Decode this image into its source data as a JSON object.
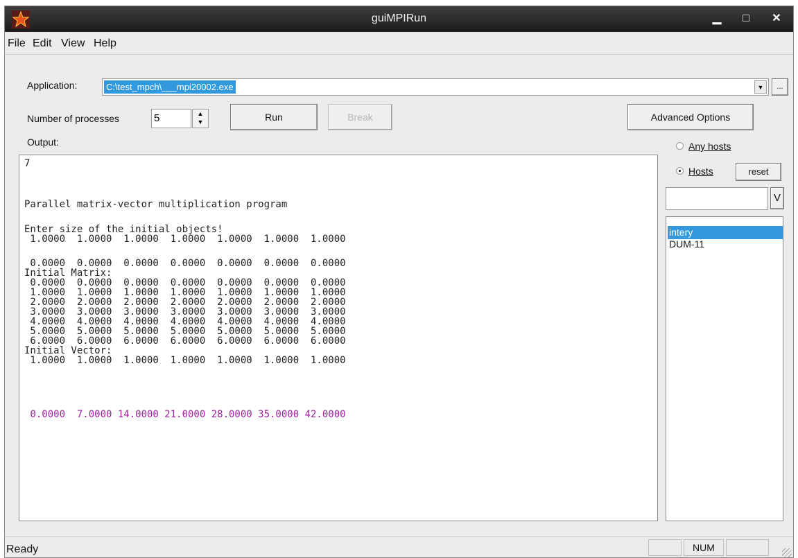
{
  "window": {
    "title": "guiMPIRun"
  },
  "menu": [
    {
      "label": "File"
    },
    {
      "label": "Edit"
    },
    {
      "label": "View"
    },
    {
      "label": "Help"
    }
  ],
  "application": {
    "label": "Application:",
    "value": "C:\\test_mpch\\___mpi20002.exe",
    "browse_label": "..."
  },
  "processes": {
    "label": "Number of processes",
    "value": "5"
  },
  "buttons": {
    "run": "Run",
    "break": "Break",
    "advanced": "Advanced Options"
  },
  "output": {
    "label": "Output:",
    "lines": [
      "7",
      "",
      "",
      "Parallel matrix-vector multiplication program",
      "",
      "Enter size of the initial objects!",
      " 1.0000  1.0000  1.0000  1.0000  1.0000  1.0000  1.0000",
      "",
      " 0.0000  0.0000  0.0000  0.0000  0.0000  0.0000  0.0000",
      "Initial Matrix:",
      " 0.0000  0.0000  0.0000  0.0000  0.0000  0.0000  0.0000",
      " 1.0000  1.0000  1.0000  1.0000  1.0000  1.0000  1.0000",
      " 2.0000  2.0000  2.0000  2.0000  2.0000  2.0000  2.0000",
      " 3.0000  3.0000  3.0000  3.0000  3.0000  3.0000  3.0000",
      " 4.0000  4.0000  4.0000  4.0000  4.0000  4.0000  4.0000",
      " 5.0000  5.0000  5.0000  5.0000  5.0000  5.0000  5.0000",
      " 6.0000  6.0000  6.0000  6.0000  6.0000  6.0000  6.0000",
      "Initial Vector:",
      " 1.0000  1.0000  1.0000  1.0000  1.0000  1.0000  1.0000"
    ],
    "result": " 0.0000  7.0000 14.0000 21.0000 28.0000 35.0000 42.0000",
    "result_color": "#a020a0"
  },
  "hosts": {
    "any_label": "Any hosts",
    "hosts_label": "Hosts",
    "reset_label": "reset",
    "dropdown_label": "V",
    "selected_mode": "Hosts",
    "list": [
      "intery",
      "DUM-11"
    ],
    "selected_item": "intery"
  },
  "status": {
    "text": "Ready",
    "num": "NUM"
  },
  "colors": {
    "selection": "#3399dd",
    "titlebar": "#2a2a2a"
  }
}
